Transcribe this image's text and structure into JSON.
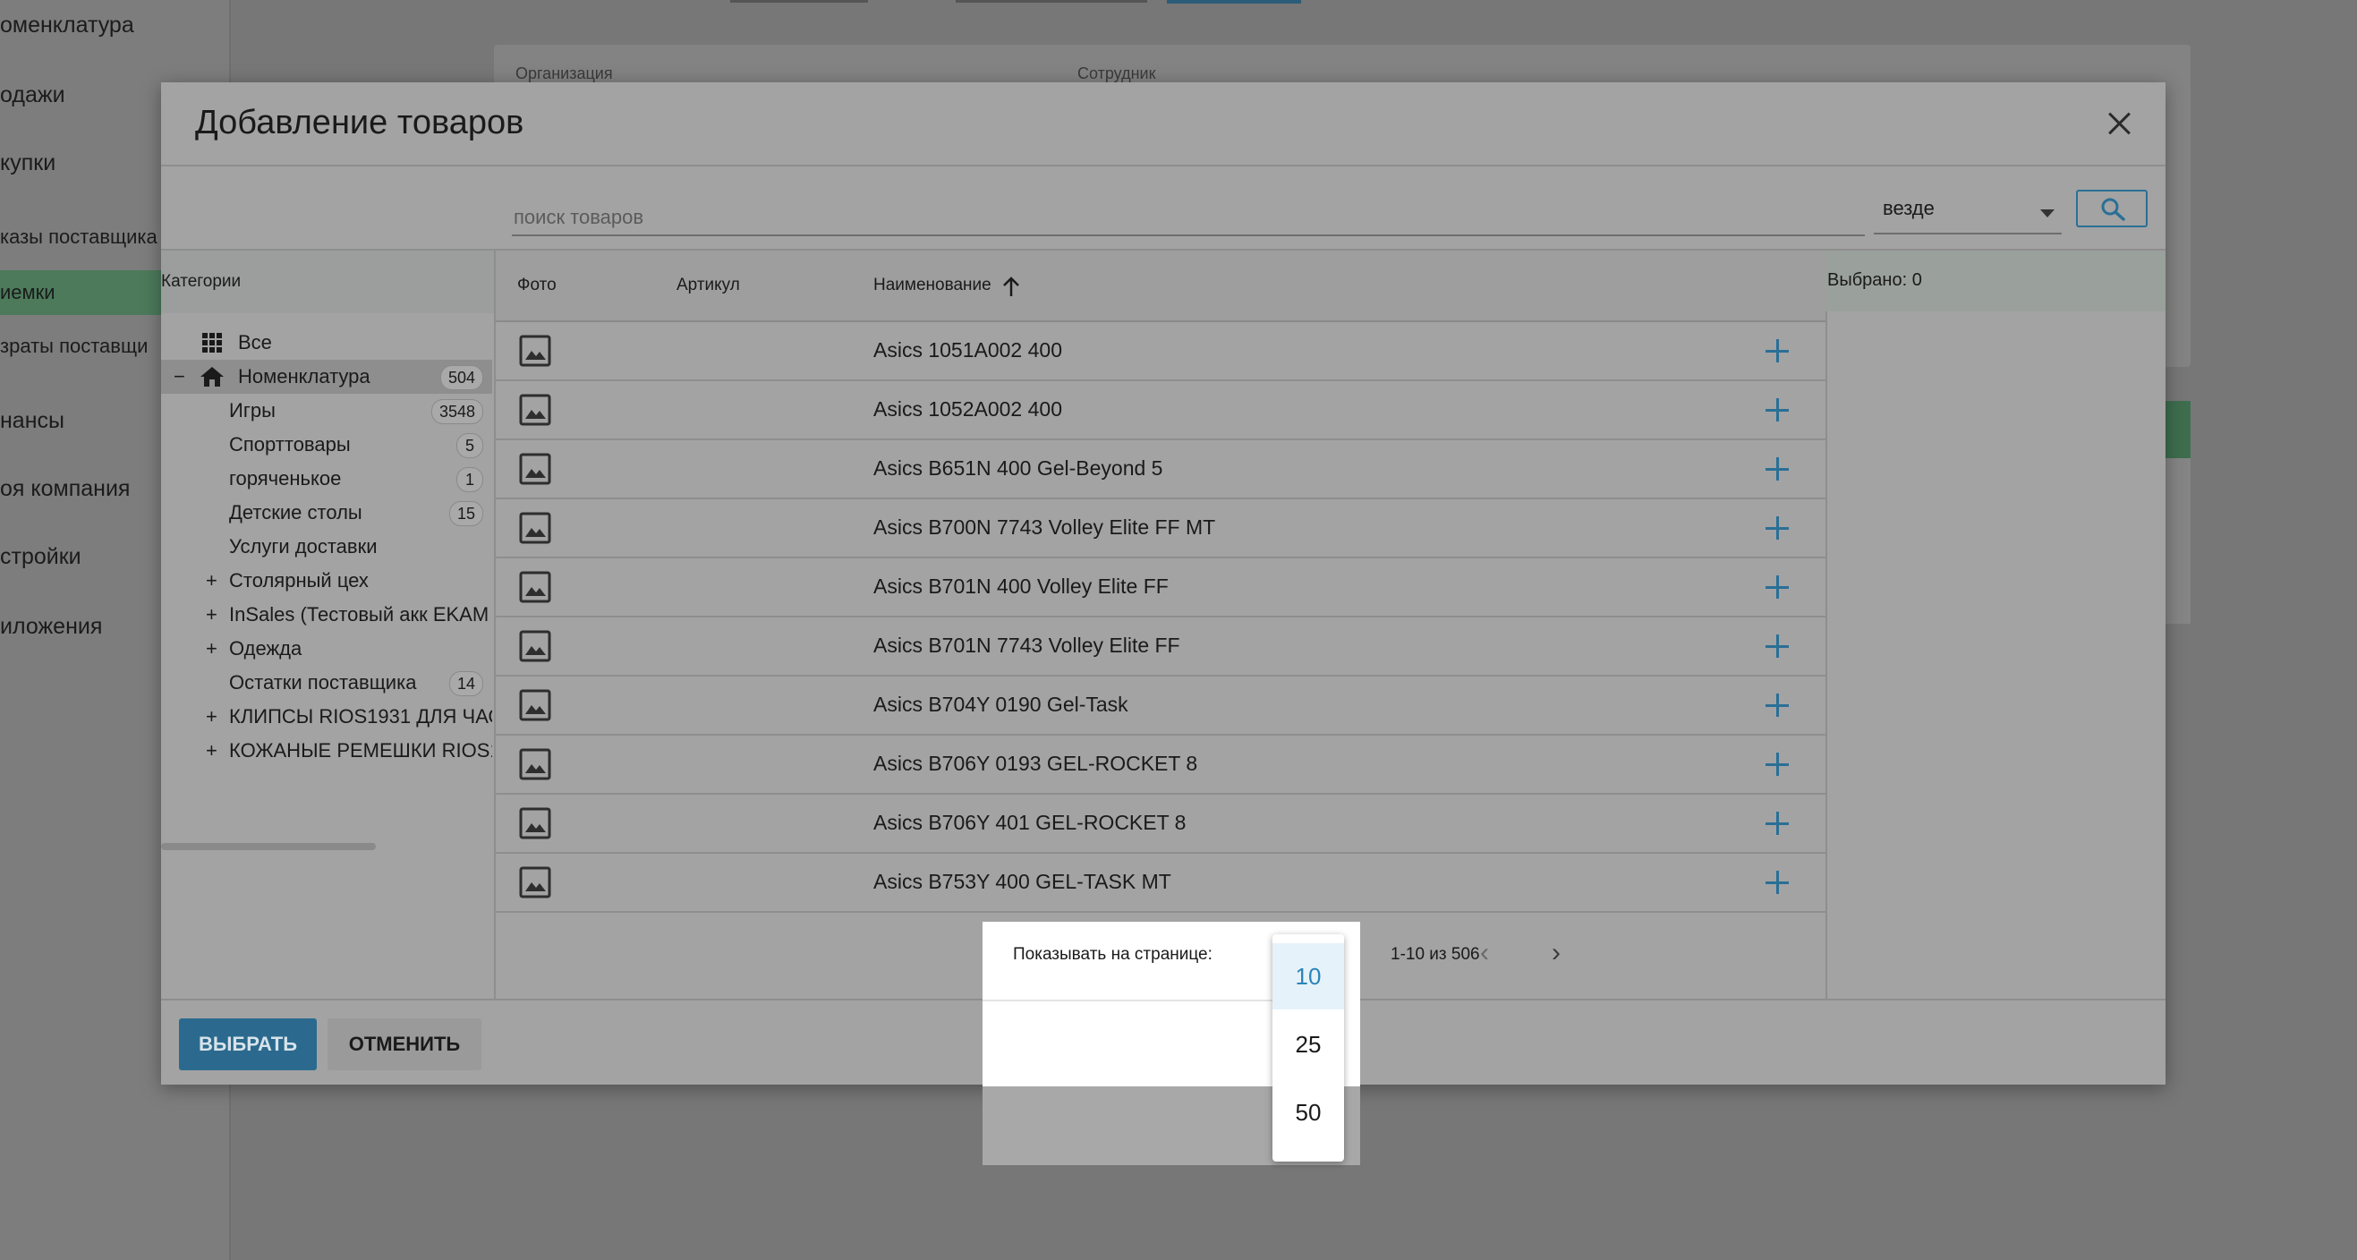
{
  "background": {
    "sidebar": [
      {
        "label": "оменклатура"
      },
      {
        "label": "одажи"
      },
      {
        "label": "купки"
      },
      {
        "label": "казы поставщика"
      },
      {
        "label": "иемки"
      },
      {
        "label": "зраты поставщи"
      },
      {
        "label": "нансы"
      },
      {
        "label": "оя компания"
      },
      {
        "label": "стройки"
      },
      {
        "label": "иложения"
      }
    ],
    "card": {
      "org_label": "Организация",
      "employee_label": "Сотрудник"
    }
  },
  "modal": {
    "title": "Добавление товаров",
    "search": {
      "placeholder": "поиск товаров",
      "value": "",
      "scope": "везде"
    },
    "categories": {
      "header": "Категории",
      "items": [
        {
          "label": "Все",
          "count": ""
        },
        {
          "label": "Номенклатура",
          "count": "504",
          "expander": "−"
        },
        {
          "label": "Игры",
          "count": "3548"
        },
        {
          "label": "Спорттовары",
          "count": "5"
        },
        {
          "label": "горяченькое",
          "count": "1"
        },
        {
          "label": "Детские столы",
          "count": "15"
        },
        {
          "label": "Услуги доставки",
          "count": ""
        },
        {
          "label": "Столярный цех",
          "count": "",
          "expander": "+"
        },
        {
          "label": "InSales (Тестовый акк EKAM",
          "count": "",
          "expander": "+"
        },
        {
          "label": "Одежда",
          "count": "",
          "expander": "+"
        },
        {
          "label": "Остатки поставщика",
          "count": "14"
        },
        {
          "label": "КЛИПСЫ RIOS1931 ДЛЯ ЧАС",
          "count": "",
          "expander": "+"
        },
        {
          "label": "КОЖАНЫЕ РЕМЕШКИ RIOS1",
          "count": "",
          "expander": "+"
        }
      ]
    },
    "table": {
      "columns": {
        "photo": "Фото",
        "article": "Артикул",
        "name": "Наименование"
      },
      "rows": [
        {
          "name": "Asics 1051A002 400"
        },
        {
          "name": "Asics 1052A002 400"
        },
        {
          "name": "Asics B651N 400 Gel-Beyond 5"
        },
        {
          "name": "Asics B700N 7743 Volley Elite FF MT"
        },
        {
          "name": "Asics B701N 400 Volley Elite FF"
        },
        {
          "name": "Asics B701N 7743 Volley Elite FF"
        },
        {
          "name": "Asics B704Y 0190 Gel-Task"
        },
        {
          "name": "Asics B706Y 0193 GEL-ROCKET 8"
        },
        {
          "name": "Asics B706Y 401 GEL-ROCKET 8"
        },
        {
          "name": "Asics B753Y 400 GEL-TASK MT"
        }
      ]
    },
    "pager": {
      "label": "Показывать на странице:",
      "range": "1-10 из 506",
      "options": [
        "10",
        "25",
        "50"
      ],
      "selected": "10"
    },
    "selected_panel": {
      "label": "Выбрано: 0"
    },
    "footer": {
      "select_label": "ВЫБРАТЬ",
      "cancel_label": "ОТМЕНИТЬ"
    }
  },
  "colors": {
    "accent": "#2a84b9",
    "primary_button": "#2b6a8e",
    "active_nav": "#4c7a5b"
  }
}
